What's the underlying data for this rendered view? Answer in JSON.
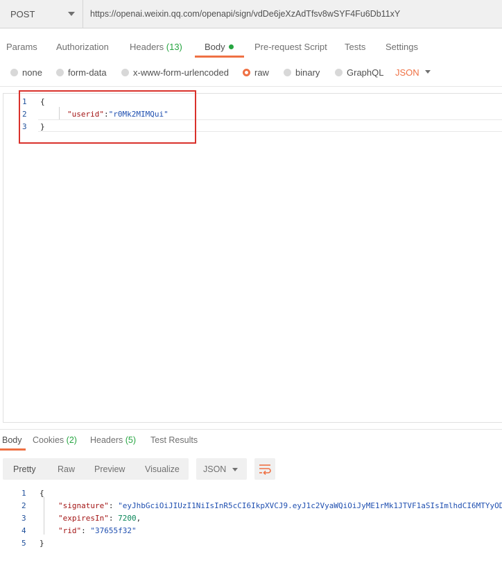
{
  "request": {
    "method": "POST",
    "url": "https://openai.weixin.qq.com/openapi/sign/vdDe6jeXzAdTfsv8wSYF4Fu6Db11xY"
  },
  "req_tabs": {
    "params": "Params",
    "authorization": "Authorization",
    "headers": "Headers",
    "headers_count": "(13)",
    "body": "Body",
    "prerequest": "Pre-request Script",
    "tests": "Tests",
    "settings": "Settings"
  },
  "body_types": {
    "none": "none",
    "form_data": "form-data",
    "urlencoded": "x-www-form-urlencoded",
    "raw": "raw",
    "binary": "binary",
    "graphql": "GraphQL",
    "format": "JSON",
    "selected": "raw"
  },
  "request_body": {
    "line_numbers": [
      "1",
      "2",
      "3"
    ],
    "open": "{",
    "key": "\"userid\"",
    "colon": ":",
    "value": "\"r0Mk2MIMQui\"",
    "close": "}"
  },
  "resp_tabs": {
    "body": "Body",
    "cookies": "Cookies",
    "cookies_count": "(2)",
    "headers": "Headers",
    "headers_count": "(5)",
    "test_results": "Test Results"
  },
  "view_modes": {
    "pretty": "Pretty",
    "raw": "Raw",
    "preview": "Preview",
    "visualize": "Visualize",
    "format": "JSON"
  },
  "response_body": {
    "line_numbers": [
      "1",
      "2",
      "3",
      "4",
      "5"
    ],
    "open": "{",
    "signature_key": "\"signature\"",
    "signature_value": "\"eyJhbGciOiJIUzI1NiIsInR5cCI6IkpXVCJ9.eyJ1c2VyaWQiOiJyME1rMk1JTVF1aSIsImlhdCI6MTYyOD",
    "expires_key": "\"expiresIn\"",
    "expires_value": "7200",
    "rid_key": "\"rid\"",
    "rid_value": "\"37655f32\"",
    "close": "}"
  },
  "colors": {
    "accent": "#ef7144",
    "count_green": "#26a541",
    "highlight_red": "#d9312b"
  }
}
